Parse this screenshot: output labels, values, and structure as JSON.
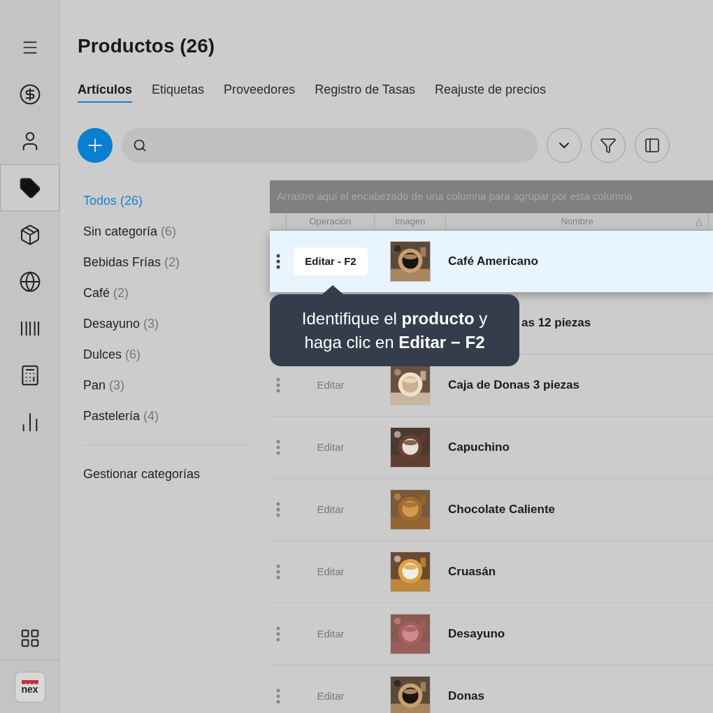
{
  "rail": {
    "items": [
      {
        "selected": false
      },
      {
        "selected": false
      },
      {
        "selected": false
      },
      {
        "selected": true
      },
      {
        "selected": false
      },
      {
        "selected": false
      },
      {
        "selected": false
      },
      {
        "selected": false
      },
      {
        "selected": false
      }
    ],
    "logo_text": "nex"
  },
  "title": "Productos (26)",
  "tabs": [
    {
      "label": "Artículos",
      "selected": true
    },
    {
      "label": "Etiquetas",
      "selected": false
    },
    {
      "label": "Proveedores",
      "selected": false
    },
    {
      "label": "Registro de Tasas",
      "selected": false
    },
    {
      "label": "Reajuste de precios",
      "selected": false
    }
  ],
  "categories": [
    {
      "name": "Todos",
      "count": "(26)",
      "selected": true
    },
    {
      "name": "Sin categoría",
      "count": "(6)",
      "selected": false
    },
    {
      "name": "Bebidas Frías",
      "count": "(2)",
      "selected": false
    },
    {
      "name": "Café",
      "count": "(2)",
      "selected": false
    },
    {
      "name": "Desayuno",
      "count": "(3)",
      "selected": false
    },
    {
      "name": "Dulces",
      "count": "(6)",
      "selected": false
    },
    {
      "name": "Pan",
      "count": "(3)",
      "selected": false
    },
    {
      "name": "Pastelería",
      "count": "(4)",
      "selected": false
    }
  ],
  "manage_link": "Gestionar categorías",
  "grid": {
    "group_hint": "Arrastre aquí el encabezado de una columna para agrupar por esta columna",
    "columns": [
      "Operación",
      "Imagen",
      "Nombre"
    ],
    "sort_mark": "△",
    "rows": [
      {
        "kind": "highlighted",
        "action": "Editar - F2",
        "name": "Café Americano"
      },
      {
        "kind": "covered",
        "name": "as 12 piezas"
      },
      {
        "kind": "normal",
        "action": "Editar",
        "name": "Caja de Donas 3 piezas"
      },
      {
        "kind": "normal",
        "action": "Editar",
        "name": "Capuchino"
      },
      {
        "kind": "normal",
        "action": "Editar",
        "name": "Chocolate Caliente"
      },
      {
        "kind": "normal",
        "action": "Editar",
        "name": "Cruasán"
      },
      {
        "kind": "normal",
        "action": "Editar",
        "name": "Desayuno"
      },
      {
        "kind": "normal",
        "action": "Editar",
        "name": "Donas"
      }
    ]
  },
  "tooltip": {
    "lines": [
      "Identifique el **producto** y",
      "haga clic en **Editar − F2**"
    ]
  }
}
